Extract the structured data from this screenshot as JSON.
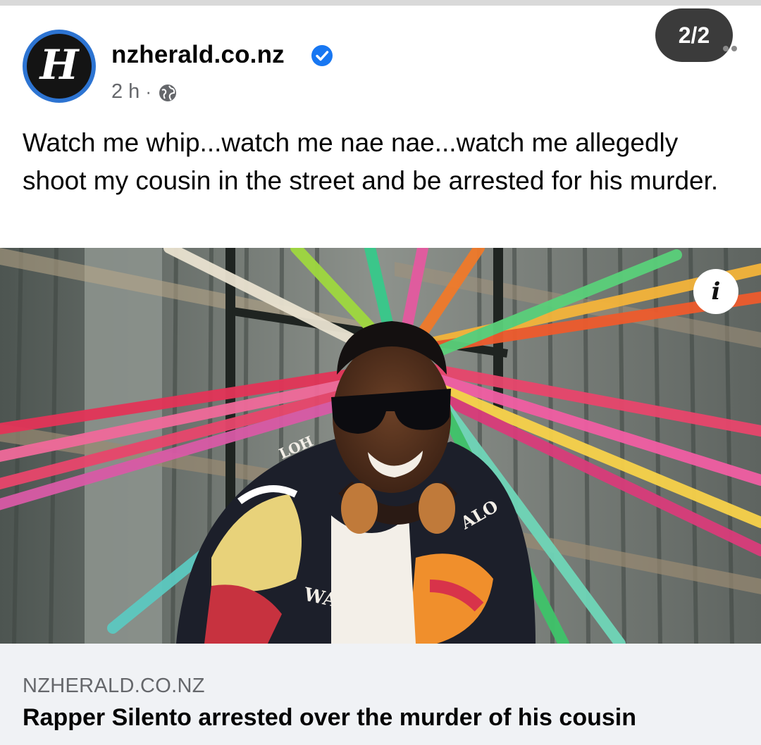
{
  "post": {
    "page_name": "nzherald.co.nz",
    "avatar_letter": "H",
    "timestamp": "2 h",
    "meta_separator": "·",
    "visibility_icon": "globe-icon",
    "verified_icon": "verified-badge-icon",
    "carousel_counter": "2/2",
    "caption": "Watch me whip...watch me nae nae...watch me allegedly shoot my cousin in the street and be arrested for his murder."
  },
  "image": {
    "info_label": "i",
    "jacket_text_1": "ALO",
    "jacket_text_2": "WAII",
    "jacket_text_3": "LOH"
  },
  "link_preview": {
    "domain": "NZHERALD.CO.NZ",
    "title": "Rapper Silento arrested over the murder of his cousin"
  },
  "colors": {
    "brand_blue": "#2d74d2",
    "verified_blue": "#1877f2",
    "meta_gray": "#65676b",
    "preview_bg": "#f0f2f5"
  }
}
